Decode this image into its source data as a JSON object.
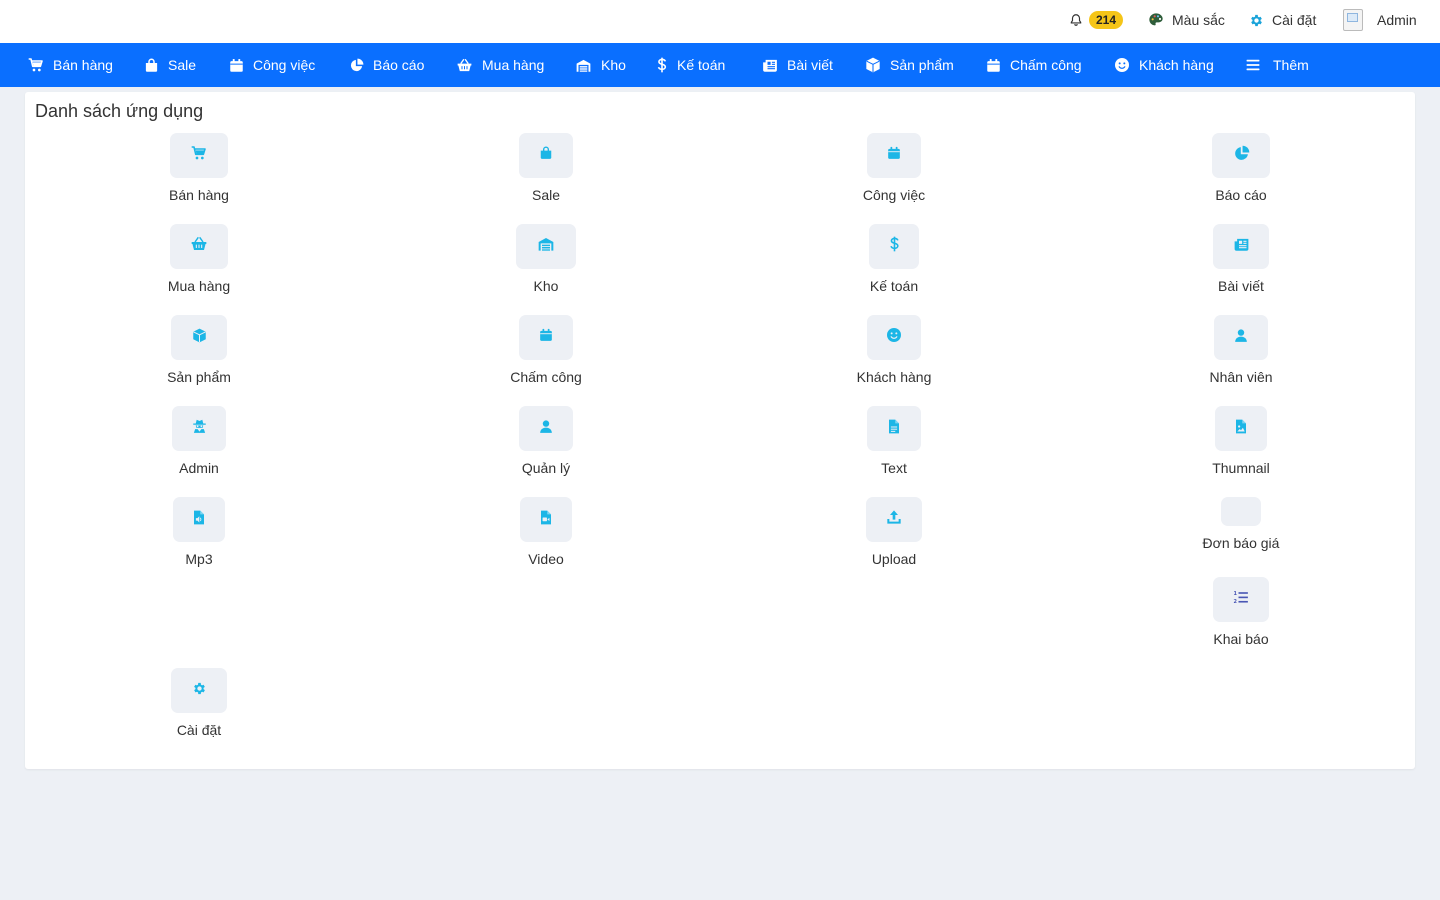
{
  "topbar": {
    "notification_count": "214",
    "colors_label": "Màu sắc",
    "settings_label": "Cài đặt",
    "user_label": "Admin"
  },
  "nav": {
    "items": [
      {
        "label": "Bán hàng",
        "icon": "cart-icon"
      },
      {
        "label": "Sale",
        "icon": "shopping-bag-icon"
      },
      {
        "label": "Công việc",
        "icon": "calendar-icon"
      },
      {
        "label": "Báo cáo",
        "icon": "pie-chart-icon"
      },
      {
        "label": "Mua hàng",
        "icon": "basket-icon"
      },
      {
        "label": "Kho",
        "icon": "warehouse-icon"
      },
      {
        "label": "Kế toán",
        "icon": "dollar-icon"
      },
      {
        "label": "Bài viết",
        "icon": "newspaper-icon"
      },
      {
        "label": "Sản phẩm",
        "icon": "box-icon"
      },
      {
        "label": "Chấm công",
        "icon": "calendar-icon"
      },
      {
        "label": "Khách hàng",
        "icon": "smile-icon"
      },
      {
        "label": "Thêm",
        "icon": "menu-icon"
      }
    ]
  },
  "main": {
    "title": "Danh sách ứng dụng",
    "apps": [
      {
        "label": "Bán hàng",
        "icon": "cart-icon"
      },
      {
        "label": "Sale",
        "icon": "shopping-bag-icon"
      },
      {
        "label": "Công việc",
        "icon": "calendar-icon"
      },
      {
        "label": "Báo cáo",
        "icon": "pie-chart-icon"
      },
      {
        "label": "Mua hàng",
        "icon": "basket-icon"
      },
      {
        "label": "Kho",
        "icon": "warehouse-icon"
      },
      {
        "label": "Kế toán",
        "icon": "dollar-icon"
      },
      {
        "label": "Bài viết",
        "icon": "newspaper-icon"
      },
      {
        "label": "Sản phẩm",
        "icon": "box-icon"
      },
      {
        "label": "Chấm công",
        "icon": "calendar-icon"
      },
      {
        "label": "Khách hàng",
        "icon": "smile-icon"
      },
      {
        "label": "Nhân viên",
        "icon": "user-icon"
      },
      {
        "label": "Admin",
        "icon": "user-secret-icon"
      },
      {
        "label": "Quản lý",
        "icon": "user-icon"
      },
      {
        "label": "Text",
        "icon": "file-text-icon"
      },
      {
        "label": "Thumnail",
        "icon": "file-image-icon"
      },
      {
        "label": "Mp3",
        "icon": "file-audio-icon"
      },
      {
        "label": "Video",
        "icon": "file-video-icon"
      },
      {
        "label": "Upload",
        "icon": "upload-icon"
      },
      {
        "label": "Đơn báo giá",
        "icon": ""
      },
      {
        "label": "Khai báo",
        "icon": "list-ol-icon"
      },
      {
        "label": "Cài đặt",
        "icon": "gear-icon"
      }
    ]
  },
  "colors": {
    "nav_bg": "#0a6fff",
    "icon_accent": "#1cb6e6",
    "list_icon": "#4a57b5",
    "badge": "#f5c518"
  }
}
